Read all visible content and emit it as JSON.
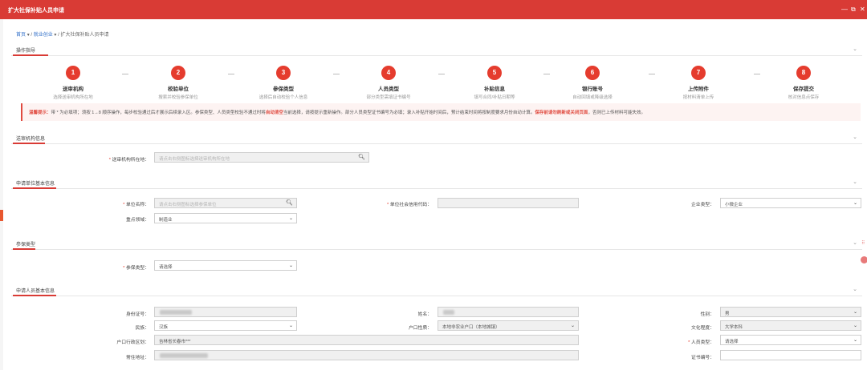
{
  "window": {
    "title": "扩大社保补贴人员申请",
    "controls": [
      "—",
      "⧉",
      "✕"
    ]
  },
  "breadcrumb": {
    "home": "首页",
    "level1": "就业创业",
    "current": "扩大社保补贴人员申请",
    "sep": "/"
  },
  "sections": {
    "guide": "操作指导",
    "agency": "送审机构信息",
    "unit": "申请单位基本信息",
    "insurance": "参保类型",
    "person": "申请人员基本信息"
  },
  "steps": [
    {
      "num": "1",
      "name": "送审机构",
      "desc": "选择送审机构所在地"
    },
    {
      "num": "2",
      "name": "校验单位",
      "desc": "搜索并校验参保单位"
    },
    {
      "num": "3",
      "name": "参保类型",
      "desc": "选择后自动校验个人信息"
    },
    {
      "num": "4",
      "name": "人员类型",
      "desc": "部分类型需填证书编号"
    },
    {
      "num": "5",
      "name": "补贴信息",
      "desc": "填写合同/补贴日期等"
    },
    {
      "num": "6",
      "name": "银行账号",
      "desc": "自动回填或降级选择"
    },
    {
      "num": "7",
      "name": "上传附件",
      "desc": "按材料清单上传"
    },
    {
      "num": "8",
      "name": "保存提交",
      "desc": "核对信息点保存"
    }
  ],
  "tips": {
    "prefix": "温馨提示：",
    "part1": "带 * 为必填项；须按 1→8 顺序操作，每步校验通过后才展示后续录入区。参保类型、人员类型校验不通过时将",
    "hl1": "自动清空",
    "part2": "当前选择，请按提示重新操作。部分人员类型证书编号为必填；录入补贴开始时间后，预计结束时间将按制度要求月份自动计算。",
    "hl2": "保存前请勿刷新或关闭页面",
    "part3": "，否则已上传材料可能失效。"
  },
  "icons": {
    "search": "search-icon",
    "dropdown": "chevron-down-icon",
    "collapse": "collapse-chevron-icon"
  },
  "accent": "#d93b35",
  "fields": {
    "agency_location": {
      "label": "送审机构所在地：",
      "placeholder": "请点击右侧图标选择送审机构所在地"
    },
    "unit_name": {
      "label": "单位名称：",
      "placeholder": "请点击右侧图标选择参保单位"
    },
    "unit_credit_code": {
      "label": "单位社会信用代码：",
      "value": ""
    },
    "enterprise_type": {
      "label": "企业类型：",
      "value": "小微企业"
    },
    "key_field": {
      "label": "重点领域：",
      "value": "制造业"
    },
    "insurance_type": {
      "label": "参保类型：",
      "value": "请选择"
    },
    "id_number": {
      "label": "身份证号："
    },
    "name": {
      "label": "姓名："
    },
    "gender": {
      "label": "性别：",
      "value": "男"
    },
    "ethnicity": {
      "label": "民族：",
      "value": "汉族"
    },
    "household_type": {
      "label": "户口性质：",
      "value": "本地非农业户口（本地城镇）"
    },
    "education": {
      "label": "文化程度：",
      "value": "大学本科"
    },
    "household_region": {
      "label": "户口行政区划：",
      "value": "吉林省长春市***"
    },
    "person_type": {
      "label": "人员类型：",
      "value": "请选择"
    },
    "residence": {
      "label": "常住地址："
    },
    "certificate_no": {
      "label": "证书编号：",
      "value": ""
    }
  }
}
